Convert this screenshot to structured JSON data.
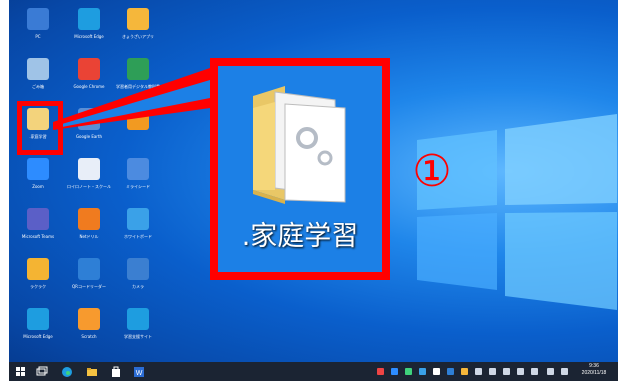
{
  "desktop_icons": [
    {
      "label": "PC",
      "name": "pc",
      "color": "#3a7bd5"
    },
    {
      "label": "Microsoft Edge",
      "name": "edge",
      "color": "#1e9de0"
    },
    {
      "label": "きょうざいアプリ",
      "name": "yellow-app",
      "color": "#f5b73b"
    },
    {
      "label": "ごみ箱",
      "name": "recycle-bin",
      "color": "#9fc3e7"
    },
    {
      "label": "Google Chrome",
      "name": "chrome",
      "color": "#ea4335"
    },
    {
      "label": "学習者用デジタル教科書",
      "name": "digital-textbook",
      "color": "#2e9e57"
    },
    {
      "label": ".家庭学習",
      "name": "home-study-folder",
      "color": "#f3d37c"
    },
    {
      "label": "Google Earth",
      "name": "google-earth",
      "color": "#5a8fd6"
    },
    {
      "label": "",
      "name": "orange-app",
      "color": "#f29a21"
    },
    {
      "label": "Zoom",
      "name": "zoom",
      "color": "#2d8cff"
    },
    {
      "label": "ロイロノート・スクール",
      "name": "loilo",
      "color": "#e8eef8"
    },
    {
      "label": "ミライシード",
      "name": "mirai-seed",
      "color": "#4c8be0"
    },
    {
      "label": "Microsoft Teams",
      "name": "teams",
      "color": "#5b5fc7"
    },
    {
      "label": "Netドリル",
      "name": "net-drill",
      "color": "#f07b1f"
    },
    {
      "label": "ホワイトボード",
      "name": "whiteboard",
      "color": "#3aa1e8"
    },
    {
      "label": "ラクラク",
      "name": "rakuraku",
      "color": "#f4b433"
    },
    {
      "label": "QRコードリーダー",
      "name": "qr-reader",
      "color": "#2e7fd6"
    },
    {
      "label": "カメラ",
      "name": "camera",
      "color": "#3b7fd1"
    },
    {
      "label": "Microsoft Edge",
      "name": "edge-2",
      "color": "#1e9de0"
    },
    {
      "label": "Scratch",
      "name": "scratch",
      "color": "#f79a2e"
    },
    {
      "label": "学習支援サイト",
      "name": "edge-3",
      "color": "#1e9de0"
    }
  ],
  "zoom_callout": {
    "label": ".家庭学習",
    "step": "①"
  },
  "clock": {
    "time": "9:36",
    "date": "2020/11/18"
  },
  "colors": {
    "highlight": "#ff0000",
    "taskbar": "#1b2433"
  }
}
